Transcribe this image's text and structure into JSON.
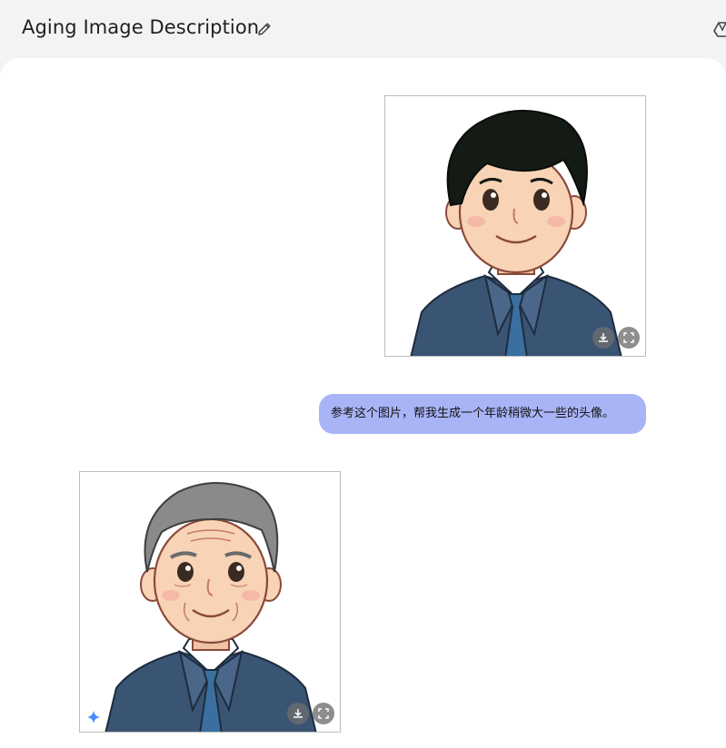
{
  "header": {
    "title": "Aging Image Description",
    "edit_icon": "pencil-icon",
    "right_icon": "drive-icon"
  },
  "conversation": {
    "user_image": {
      "alt": "cartoon young man in suit",
      "hair_color": "#141a14",
      "actions": [
        "download-icon",
        "fullscreen-icon"
      ]
    },
    "user_message": "参考这个图片，帮我生成一个年龄稍微大一些的头像。",
    "model_image": {
      "alt": "cartoon older man in suit",
      "hair_color": "#8a8a8a",
      "actions": [
        "download-icon",
        "fullscreen-icon"
      ],
      "badge_icon": "sparkle-icon"
    }
  },
  "colors": {
    "bubble": "#a8b4f6",
    "suit": "#3a5474",
    "tie": "#3a6fa0",
    "skin": "#f8d3b6",
    "sparkle": "#4a8cff"
  }
}
